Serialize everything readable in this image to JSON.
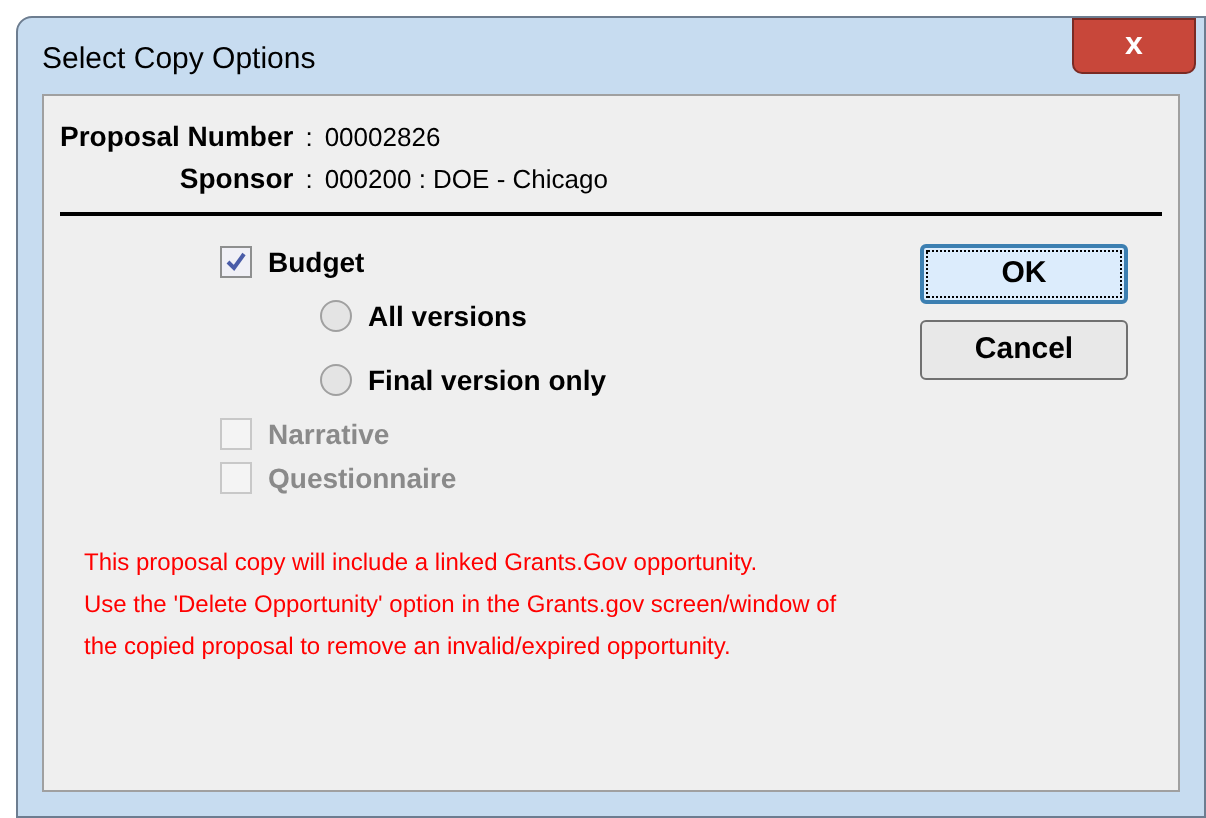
{
  "window": {
    "title": "Select Copy Options",
    "close": "x"
  },
  "header": {
    "fields": [
      {
        "label": "Proposal Number",
        "separator": ":",
        "value": "00002826"
      },
      {
        "label": "Sponsor",
        "separator": ":",
        "value": "000200 : DOE - Chicago"
      }
    ]
  },
  "options": [
    {
      "kind": "checkbox",
      "label": "Budget",
      "checked": true,
      "disabled": false
    },
    {
      "kind": "radio",
      "label": "All versions",
      "selected": false
    },
    {
      "kind": "radio",
      "label": "Final version only",
      "selected": false
    },
    {
      "kind": "checkbox",
      "label": "Narrative",
      "checked": false,
      "disabled": true
    },
    {
      "kind": "checkbox",
      "label": "Questionnaire",
      "checked": false,
      "disabled": true
    }
  ],
  "buttons": [
    {
      "label": "OK",
      "focused": true
    },
    {
      "label": "Cancel",
      "focused": false
    }
  ],
  "notice": [
    "This proposal copy will include a linked Grants.Gov opportunity.",
    "Use the 'Delete Opportunity' option in the Grants.gov screen/window of",
    "the copied proposal to remove an invalid/expired opportunity."
  ]
}
